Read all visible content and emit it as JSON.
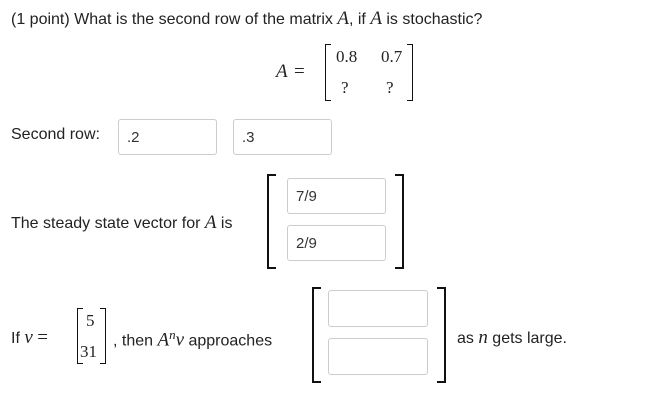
{
  "question": {
    "header": "(1 point) What is the second row of the matrix ",
    "var_A": "A",
    "mid": ", if ",
    "tail": " is stochastic?"
  },
  "matrix": {
    "lhs": "A",
    "eq": "=",
    "cells": [
      "0.8",
      "0.7",
      "?",
      "?"
    ]
  },
  "second_row": {
    "label": "Second row:",
    "inputs": [
      ".2",
      ".3"
    ]
  },
  "steady_state": {
    "label_pre": "The steady state vector for ",
    "label_var": "A",
    "label_post": " is",
    "inputs": [
      "7/9",
      "2/9"
    ]
  },
  "limit": {
    "if_text": "If ",
    "v": "v",
    "eq": "=",
    "vector": [
      "5",
      "31"
    ],
    "then_text": ", then ",
    "A": "A",
    "n": "n",
    "v2": "v",
    "approaches": " approaches",
    "inputs": [
      "",
      ""
    ],
    "as_text": "as ",
    "n2": "n",
    "gets_large": " gets large."
  }
}
